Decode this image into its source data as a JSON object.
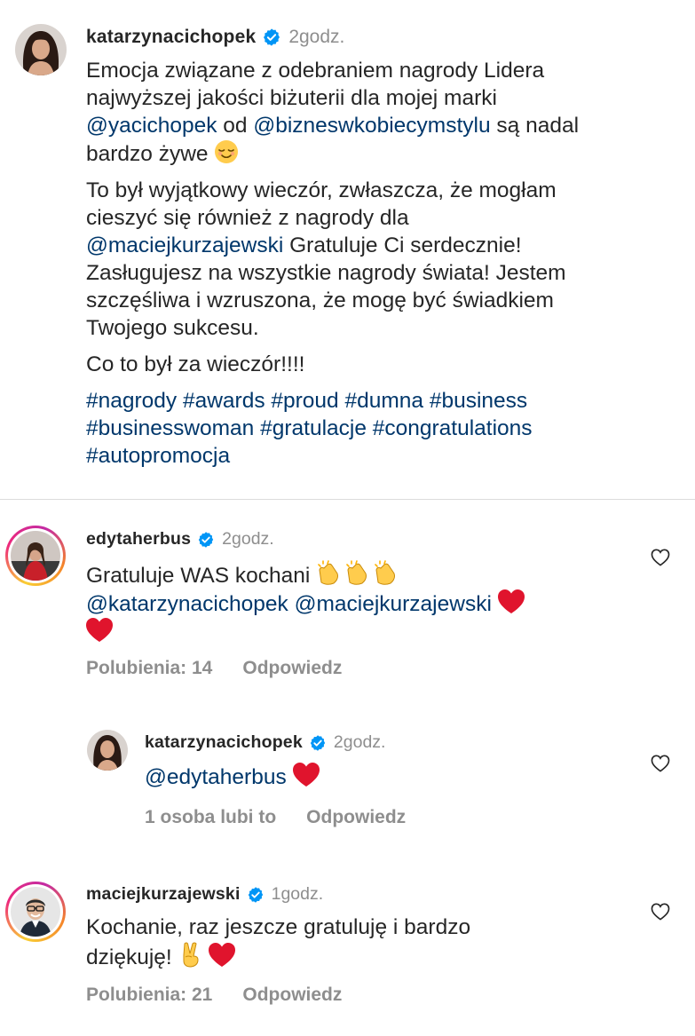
{
  "post": {
    "username": "katarzynacichopek",
    "time": "2godz.",
    "para1": {
      "t1": "Emocja związane z odebraniem nagrody Lidera",
      "t2": "najwyższej jakości biżuterii dla mojej marki",
      "m1": "@yacichopek",
      "t3": " od ",
      "m2": "@bizneswkobiecymstylu",
      "t4": " są nadal",
      "t5": "bardzo żywe"
    },
    "para2": {
      "t1": "To był wyjątkowy wieczór, zwłaszcza, że mogłam",
      "t2": "cieszyć się również z nagrody dla",
      "m1": "@maciejkurzajewski",
      "t3": " Gratuluje Ci serdecznie!",
      "t4": "Zasługujesz na wszystkie nagrody świata! Jestem",
      "t5": "szczęśliwa i wzruszona, że mogę być świadkiem",
      "t6": "Twojego sukcesu."
    },
    "para3": "Co to był za wieczór!!!!",
    "hashtags_line1": "#nagrody #awards #proud #dumna #business",
    "hashtags_line2": "#businesswoman #gratulacje #congratulations",
    "hashtags_line3": "#autopromocja"
  },
  "comments": [
    {
      "username": "edytaherbus",
      "time": "2godz.",
      "text1": "Gratuluje WAS kochani",
      "m1": "@katarzynacichopek",
      "m2": "@maciejkurzajewski",
      "likes": "Polubienia: 14",
      "reply": "Odpowiedz"
    },
    {
      "username": "katarzynacichopek",
      "time": "2godz.",
      "m1": "@edytaherbus",
      "likes": "1 osoba lubi to",
      "reply": "Odpowiedz"
    },
    {
      "username": "maciejkurzajewski",
      "time": "1godz.",
      "text1": "Kochanie, raz jeszcze gratuluję i bardzo",
      "text2": "dziękuję!",
      "likes": "Polubienia: 21",
      "reply": "Odpowiedz"
    }
  ],
  "colors": {
    "mention": "#00376b",
    "muted": "#8e8e8e",
    "verified": "#0095f6",
    "heart_emoji": "#e0142d"
  },
  "icons": [
    "verified-badge-icon",
    "heart-outline-icon",
    "relieved-face-emoji",
    "clapping-hands-emoji",
    "red-heart-emoji",
    "victory-hand-emoji"
  ]
}
